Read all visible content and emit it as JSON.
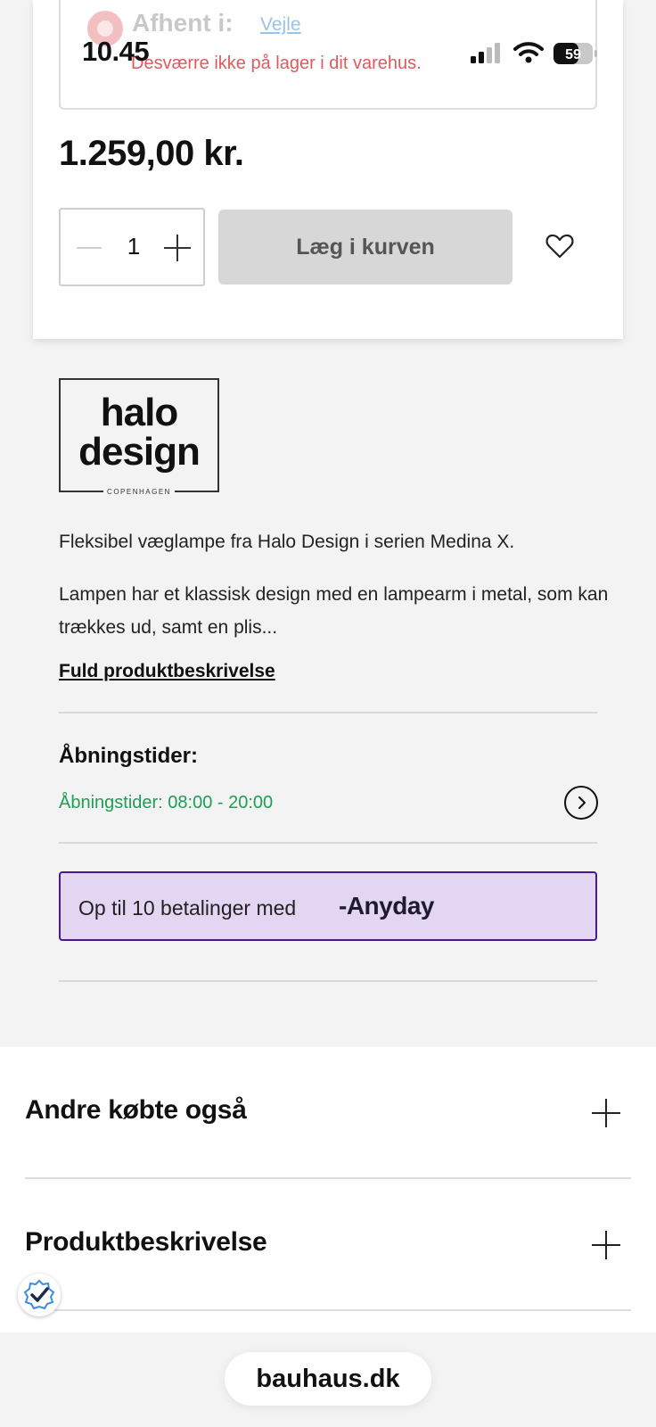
{
  "status_bar": {
    "time": "10.45",
    "battery": "59"
  },
  "pickup": {
    "label": "Afhent i:",
    "store": "Vejle",
    "stock_message": "Desværre ikke på lager i dit varehus."
  },
  "product": {
    "price": "1.259,00 kr.",
    "quantity": "1",
    "add_to_cart_label": "Læg i kurven"
  },
  "brand": {
    "line1": "halo",
    "line2": "design",
    "city": "COPENHAGEN"
  },
  "description": {
    "short": "Fleksibel væglampe fra Halo Design i serien Medina X.",
    "long": "Lampen har et klassisk design med en lampearm i metal, som kan trækkes ud, samt en plis...",
    "link_label": "Fuld produktbeskrivelse"
  },
  "opening_hours": {
    "title": "Åbningstider:",
    "value": "Åbningstider: 08:00 - 20:00"
  },
  "anyday": {
    "text": "Op til 10 betalinger med",
    "brand": "Anyday"
  },
  "accordions": [
    {
      "title": "Andre købte også"
    },
    {
      "title": "Produktbeskrivelse"
    }
  ],
  "browser": {
    "url": "bauhaus.dk"
  },
  "colors": {
    "stock_error": "#dd5a5d",
    "hours_green": "#1f9d55",
    "anyday_bg": "#e3d6f3",
    "anyday_border": "#4a1a8c"
  }
}
